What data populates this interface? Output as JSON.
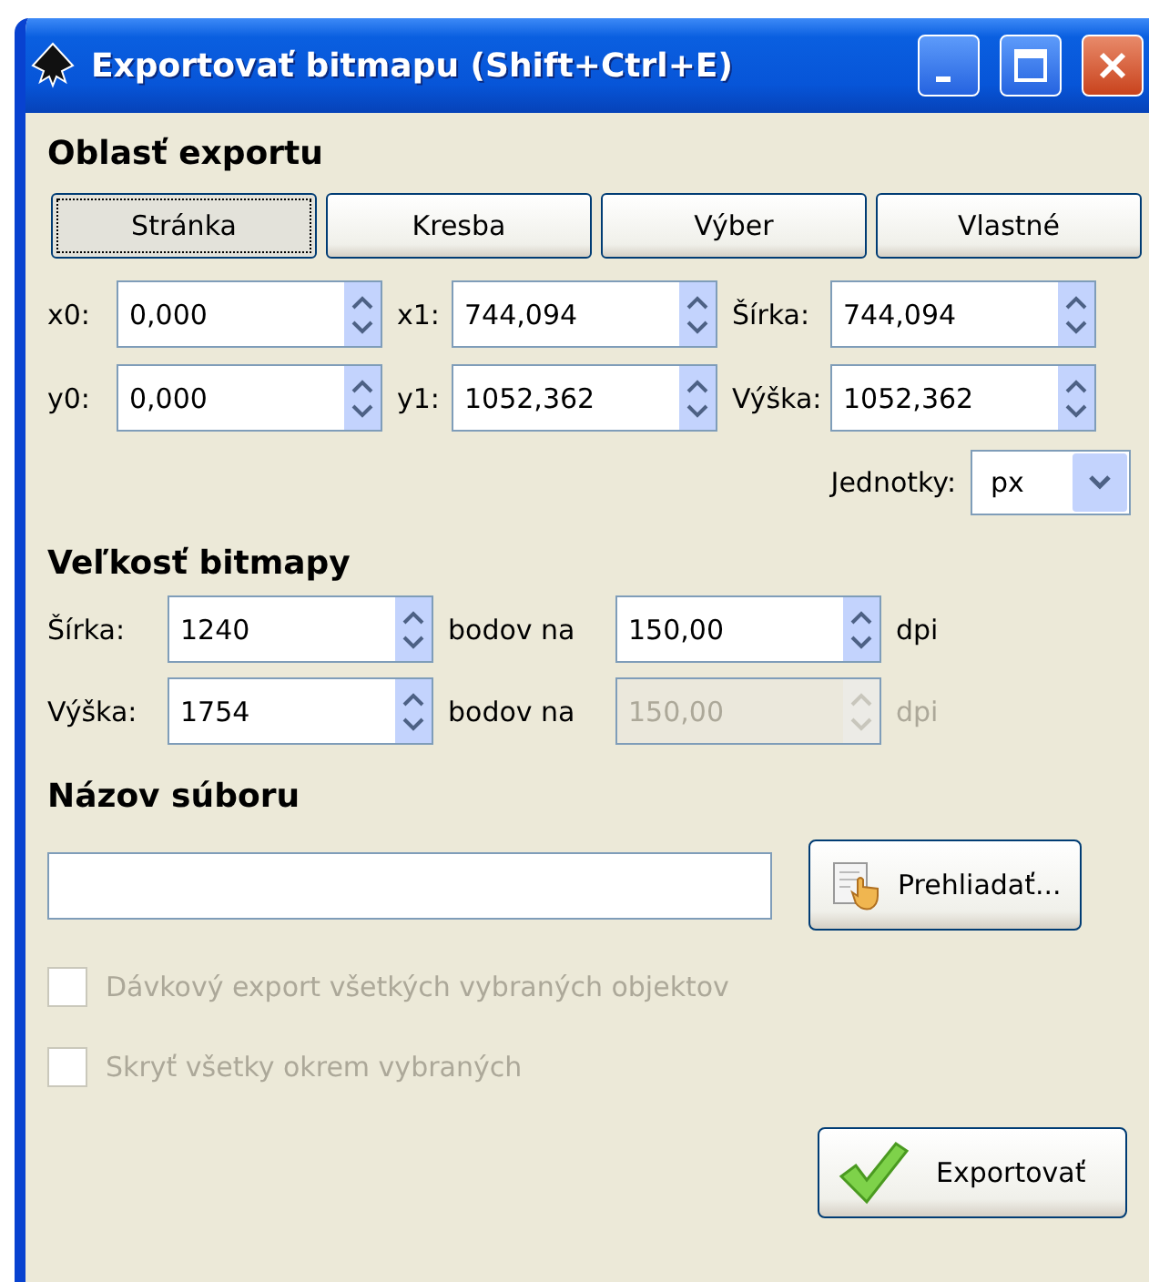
{
  "window": {
    "title": "Exportovať bitmapu (Shift+Ctrl+E)"
  },
  "export_area": {
    "heading": "Oblasť exportu",
    "buttons": [
      {
        "label": "Stránka",
        "selected": true
      },
      {
        "label": "Kresba",
        "selected": false
      },
      {
        "label": "Výber",
        "selected": false
      },
      {
        "label": "Vlastné",
        "selected": false
      }
    ],
    "fields": [
      {
        "label": "x0:",
        "value": "0,000"
      },
      {
        "label": "x1:",
        "value": "744,094"
      },
      {
        "label": "Šírka:",
        "value": "744,094"
      },
      {
        "label": "y0:",
        "value": "0,000"
      },
      {
        "label": "y1:",
        "value": "1052,362"
      },
      {
        "label": "Výška:",
        "value": "1052,362"
      }
    ],
    "units": {
      "label": "Jednotky:",
      "value": "px"
    }
  },
  "bitmap_size": {
    "heading": "Veľkosť bitmapy",
    "rows": [
      {
        "label": "Šírka:",
        "value": "1240",
        "per": "bodov na",
        "dpi_value": "150,00",
        "dpi_unit": "dpi",
        "disabled": false
      },
      {
        "label": "Výška:",
        "value": "1754",
        "per": "bodov na",
        "dpi_value": "150,00",
        "dpi_unit": "dpi",
        "disabled": true
      }
    ]
  },
  "filename": {
    "heading": "Názov súboru",
    "browse": "Prehliadať..."
  },
  "options": [
    {
      "label": "Dávkový export všetkých vybraných objektov",
      "checked": false,
      "disabled": true
    },
    {
      "label": "Skryť všetky okrem vybraných",
      "checked": false,
      "disabled": true
    }
  ],
  "export_button": "Exportovať"
}
